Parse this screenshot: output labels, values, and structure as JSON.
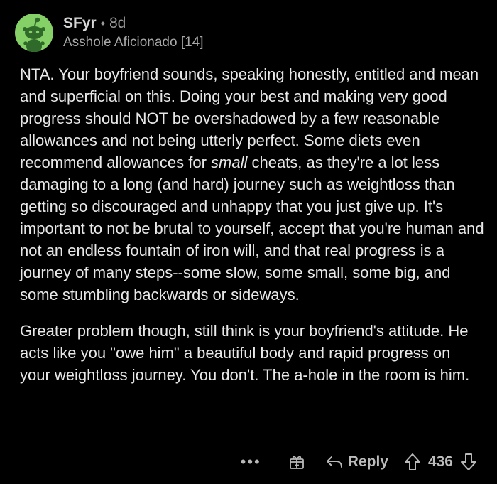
{
  "author": {
    "username": "SFyr",
    "separator": "•",
    "age": "8d",
    "flair": "Asshole Aficionado [14]"
  },
  "comment": {
    "p1_a": "NTA. Your boyfriend sounds, speaking honestly, entitled and mean and superficial on this. Doing your best and making very good progress should NOT be overshadowed by a few reasonable allowances and not being utterly perfect. Some diets even recommend allowances for ",
    "p1_em": "small",
    "p1_b": " cheats, as they're a lot less damaging to a long (and hard) journey such as weightloss than getting so discouraged and unhappy that you just give up. It's important to not be brutal to yourself, accept that you're human and not an endless fountain of iron will, and that real progress is a journey of many steps--some slow, some small, some big, and some stumbling backwards or sideways.",
    "p2": "Greater problem though, still think is your boyfriend's attitude. He acts like you \"owe him\" a beautiful body and rapid progress on your weightloss journey. You don't. The a-hole in the room is him."
  },
  "actions": {
    "more": "•••",
    "reply_label": "Reply",
    "score": "436"
  },
  "colors": {
    "background": "#000000",
    "avatar": "#86d167",
    "text": "#e8e8e8",
    "muted": "#9a9a9a"
  },
  "icons": {
    "avatar": "snoo-avatar-icon",
    "more": "more-options-icon",
    "award": "gift-award-icon",
    "reply": "reply-arrow-icon",
    "upvote": "upvote-arrow-icon",
    "downvote": "downvote-arrow-icon"
  }
}
